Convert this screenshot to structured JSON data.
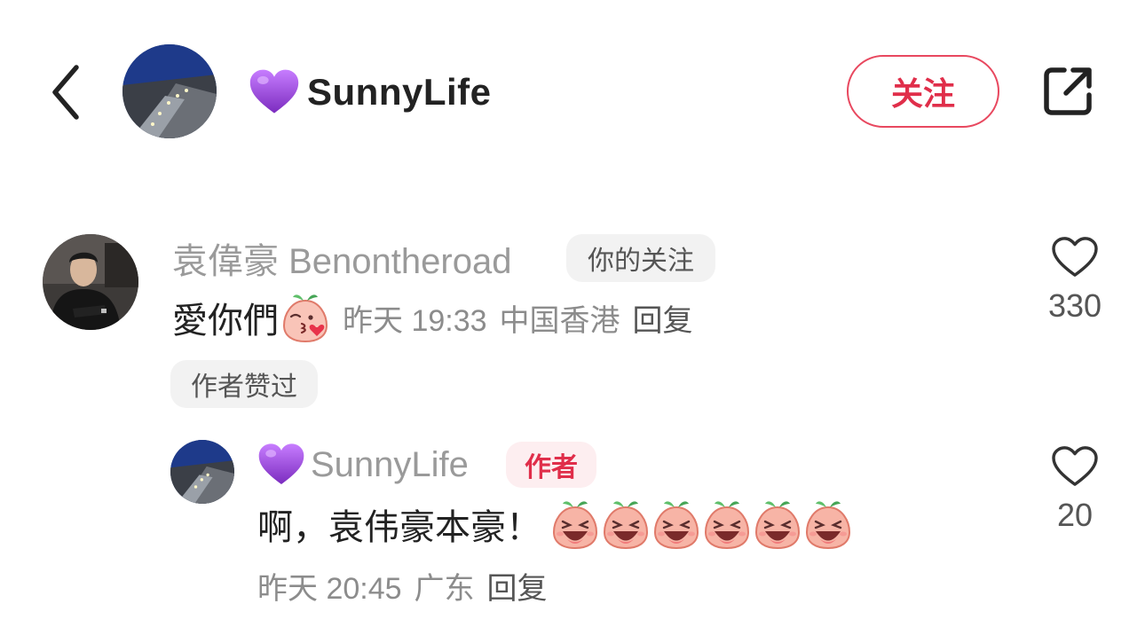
{
  "header": {
    "back_icon": "chevron-left-icon",
    "user_name": "SunnyLife",
    "name_emoji": "purple-heart-emoji",
    "follow_label": "关注",
    "share_icon": "share-external-icon",
    "accent_color": "#e02e4a"
  },
  "comments": [
    {
      "username": "袁偉豪 Benontheroad",
      "relation_tag": "你的关注",
      "text": "愛你們",
      "emoji": "peach-kiss-emoji",
      "time": "昨天 19:33",
      "location": "中国香港",
      "reply_label": "回复",
      "author_liked_tag": "作者赞过",
      "like_count": "330"
    },
    {
      "username": "SunnyLife",
      "name_emoji": "purple-heart-emoji",
      "author_tag": "作者",
      "text": "啊，袁伟豪本豪！",
      "emojis": [
        "peach-laugh-emoji",
        "peach-laugh-emoji",
        "peach-laugh-emoji",
        "peach-laugh-emoji",
        "peach-laugh-emoji",
        "peach-laugh-emoji"
      ],
      "time": "昨天 20:45",
      "location": "广东",
      "reply_label": "回复",
      "like_count": "20"
    }
  ]
}
